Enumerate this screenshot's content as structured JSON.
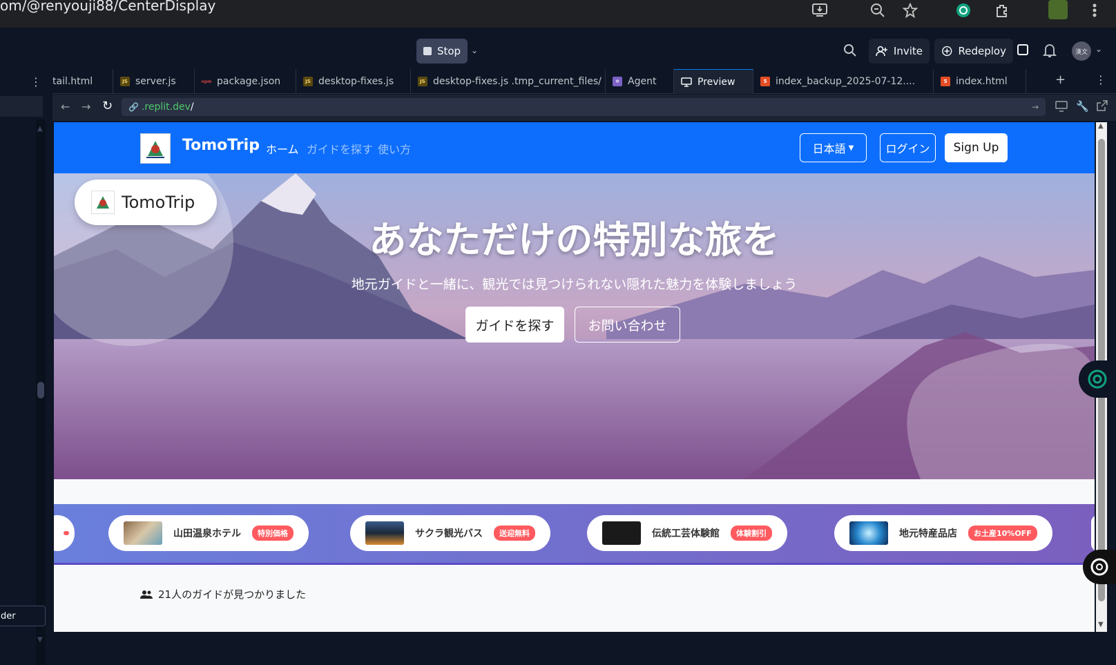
{
  "browser": {
    "url": "om/@renyouji88/CenterDisplay"
  },
  "replit": {
    "stop_label": "Stop",
    "invite_label": "Invite",
    "redeploy_label": "Redeploy",
    "avatar_text": "漢文",
    "tabs": [
      {
        "label": "tail.html",
        "icon": "file-icon"
      },
      {
        "label": "server.js",
        "icon": "js-icon"
      },
      {
        "label": "package.json",
        "icon": "json-icon"
      },
      {
        "label": "desktop-fixes.js",
        "icon": "js-icon"
      },
      {
        "label": "desktop-fixes.js .tmp_current_files/",
        "icon": "js-icon"
      },
      {
        "label": "Agent",
        "icon": "agent-icon"
      },
      {
        "label": "Preview",
        "icon": "monitor-icon"
      },
      {
        "label": "index_backup_2025-07-12....",
        "icon": "html-icon"
      },
      {
        "label": "index.html",
        "icon": "html-icon"
      }
    ],
    "address_host": ".replit.dev",
    "address_path": "/",
    "sidebar_search_text": "der"
  },
  "site": {
    "brand": "TomoTrip",
    "nav": [
      "ホーム",
      "ガイドを探す",
      "使い方"
    ],
    "language_label": "日本語",
    "login_label": "ログイン",
    "signup_label": "Sign Up",
    "hero_badge": "TomoTrip",
    "hero_title": "あなただけの特別な旅を",
    "hero_subtitle": "地元ガイドと一緒に、観光では見つけられない隠れた魅力を体験しましょう",
    "hero_primary_btn": "ガイドを探す",
    "hero_secondary_btn": "お問い合わせ",
    "partners": [
      {
        "name": "山田温泉ホテル",
        "badge": "特別価格"
      },
      {
        "name": "サクラ観光バス",
        "badge": "送迎無料"
      },
      {
        "name": "伝統工芸体験館",
        "badge": "体験割引"
      },
      {
        "name": "地元特産品店",
        "badge": "お土産10%OFF"
      }
    ],
    "guides_found": "21人のガイドが見つかりました"
  },
  "colors": {
    "navbar": "#0d6efd",
    "badge": "#ff5a5f",
    "replit_bg": "#0e1525"
  }
}
